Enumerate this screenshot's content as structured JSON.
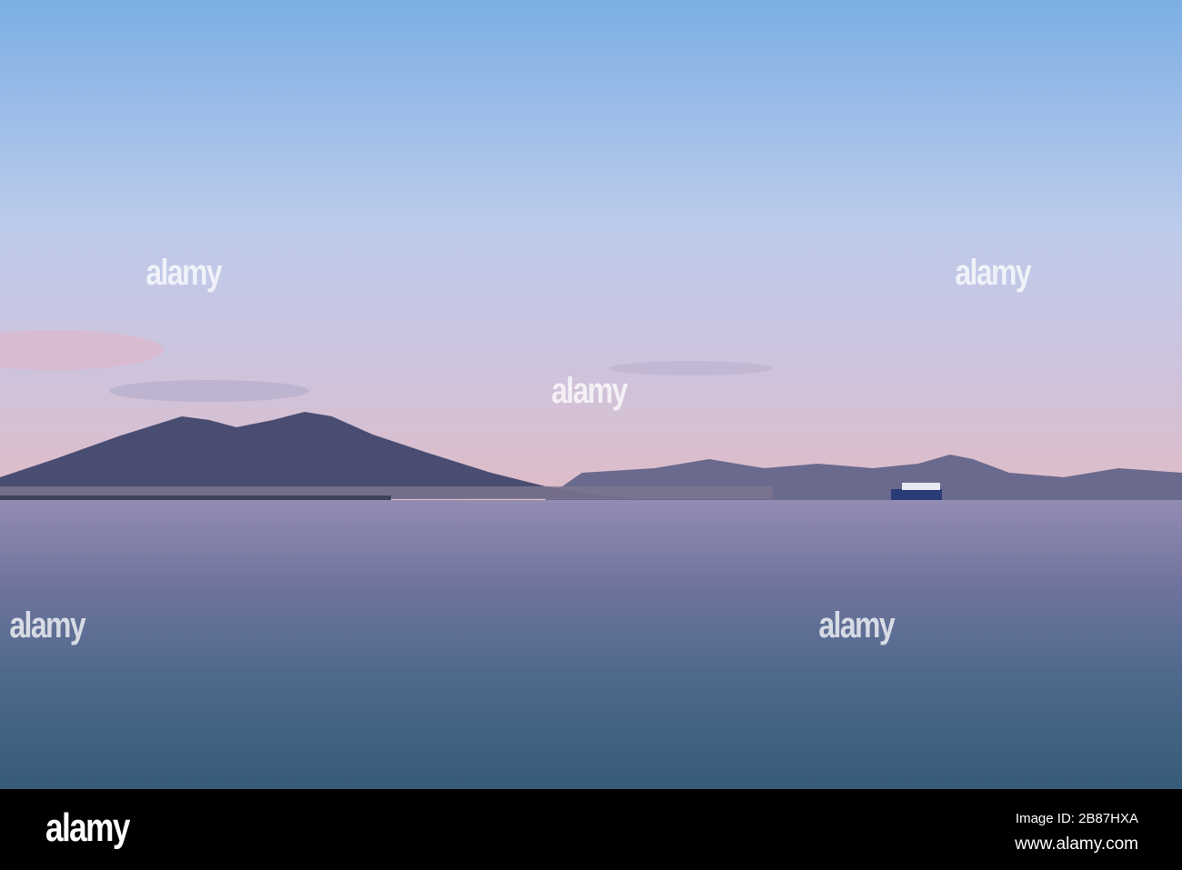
{
  "photo": {
    "subject": "vesuvius-bay-of-naples-dusk",
    "colors": {
      "sky_top": "#7fb0e4",
      "sky_mid": "#c6d0ea",
      "sky_horizon": "#dcbdcb",
      "sea_top": "#8c88b0",
      "sea_bottom": "#3a5f7c",
      "mountain": "#4a4d72"
    }
  },
  "watermark": {
    "text": "alamy"
  },
  "footer": {
    "logo": "alamy",
    "image_id": "Image ID: 2B87HXA",
    "url": "www.alamy.com"
  }
}
